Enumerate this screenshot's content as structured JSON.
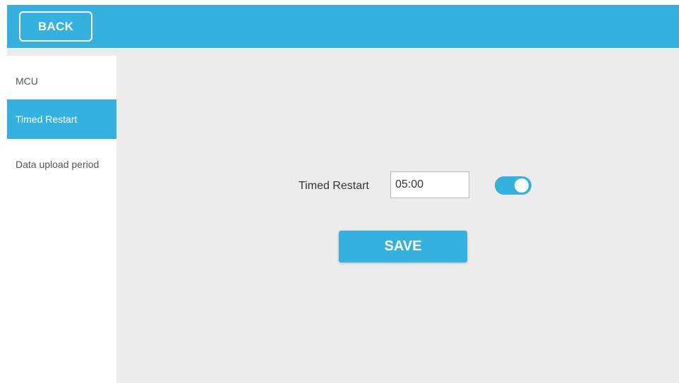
{
  "header": {
    "back_label": "BACK"
  },
  "sidebar": {
    "items": [
      {
        "label": "MCU",
        "active": false
      },
      {
        "label": "Timed Restart",
        "active": true
      },
      {
        "label": "Data upload period",
        "active": false
      }
    ]
  },
  "main": {
    "timed_restart_label": "Timed Restart",
    "time_value": "05:00",
    "toggle_enabled": true,
    "save_label": "SAVE"
  },
  "colors": {
    "accent": "#35b1e0",
    "background": "#ececec"
  }
}
